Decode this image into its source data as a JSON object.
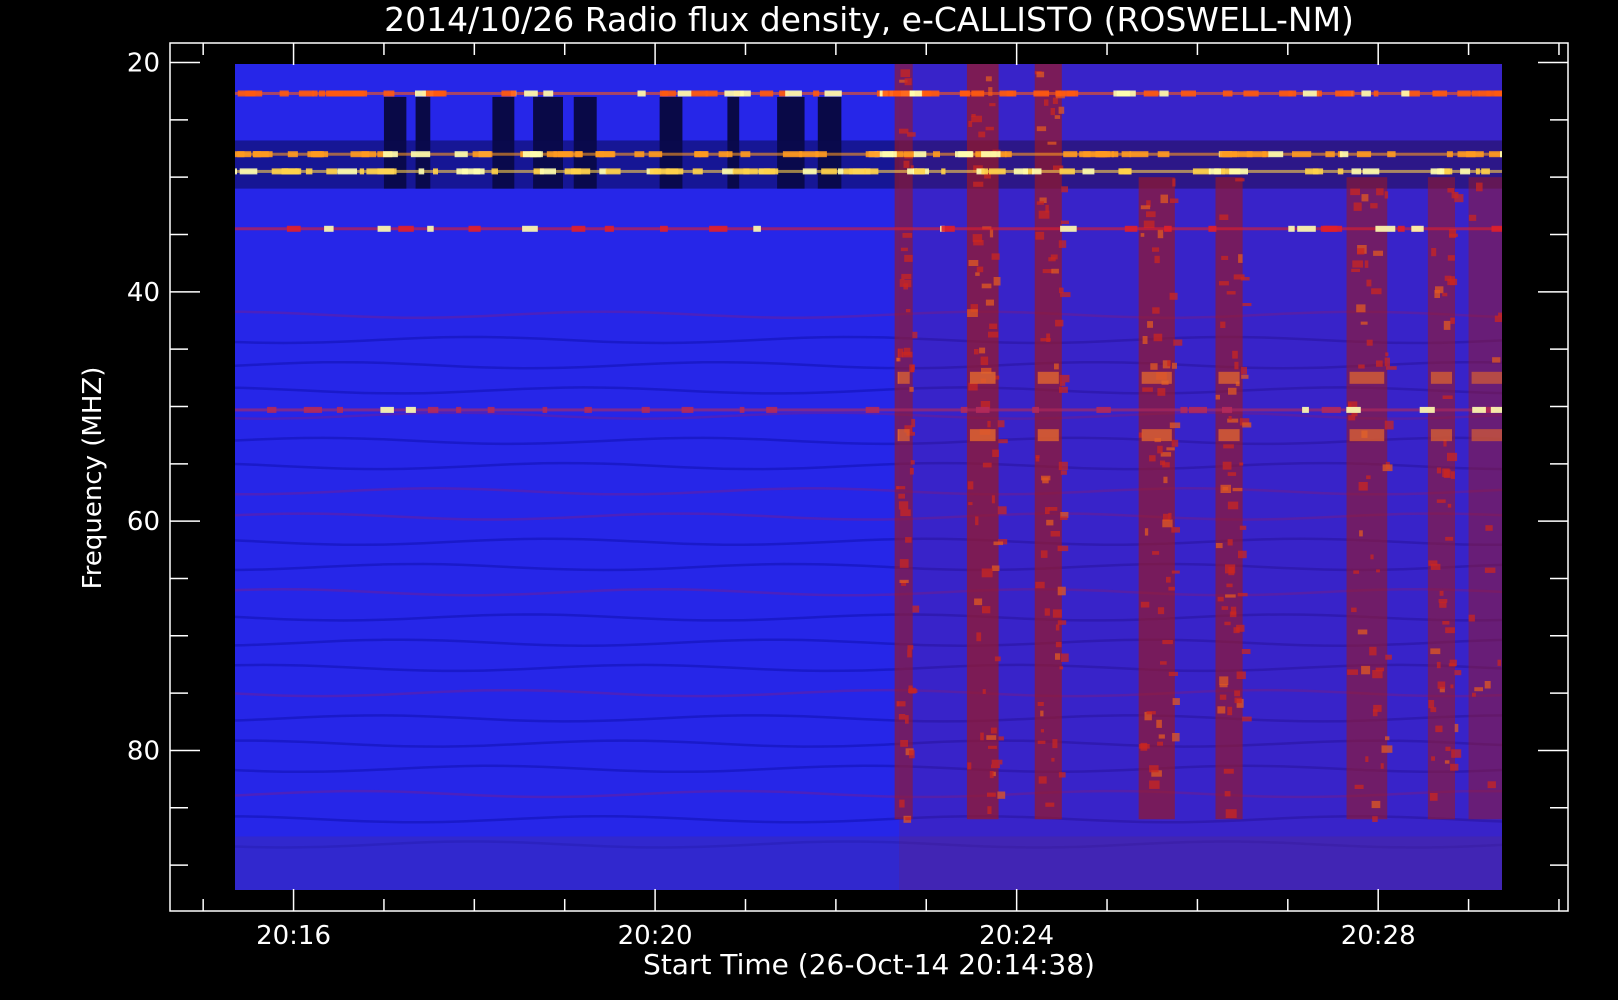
{
  "chart_data": {
    "type": "heatmap",
    "title": "2014/10/26  Radio flux density, e-CALLISTO (ROSWELL-NM)",
    "xlabel": "Start Time (26-Oct-14 20:14:38)",
    "ylabel": "Frequency (MHZ)",
    "x_ticks": [
      "20:16",
      "20:20",
      "20:24",
      "20:28"
    ],
    "x_tick_minutes": [
      16,
      20,
      24,
      28
    ],
    "x_range_minutes": [
      14.633,
      30.1
    ],
    "data_range_minutes": [
      15.0,
      30.0
    ],
    "y_ticks": [
      20,
      40,
      60,
      80
    ],
    "ylim": [
      18.3,
      94.0
    ],
    "data_freq_range_mhz": [
      20.0,
      92.3
    ],
    "y_axis_inverted": true,
    "colormap": [
      "#000000",
      "#1e1eff",
      "#b41414",
      "#ff4a00",
      "#ffd24a",
      "#ffffb0"
    ],
    "background_color": "#2626e8",
    "burst_onset_minute": 22.7,
    "bursts": [
      {
        "start_min": 22.65,
        "end_min": 22.85,
        "f_top_mhz": 20.0,
        "f_bottom_mhz": 86.0,
        "intensity": 0.55
      },
      {
        "start_min": 23.45,
        "end_min": 23.8,
        "f_top_mhz": 20.0,
        "f_bottom_mhz": 86.0,
        "intensity": 0.8
      },
      {
        "start_min": 24.2,
        "end_min": 24.5,
        "f_top_mhz": 20.0,
        "f_bottom_mhz": 86.0,
        "intensity": 0.75
      },
      {
        "start_min": 25.35,
        "end_min": 25.75,
        "f_top_mhz": 30.0,
        "f_bottom_mhz": 86.0,
        "intensity": 0.7
      },
      {
        "start_min": 26.2,
        "end_min": 26.5,
        "f_top_mhz": 30.0,
        "f_bottom_mhz": 86.0,
        "intensity": 0.65
      },
      {
        "start_min": 27.65,
        "end_min": 28.1,
        "f_top_mhz": 30.0,
        "f_bottom_mhz": 86.0,
        "intensity": 0.55
      },
      {
        "start_min": 28.55,
        "end_min": 28.85,
        "f_top_mhz": 30.0,
        "f_bottom_mhz": 86.0,
        "intensity": 0.5
      },
      {
        "start_min": 29.0,
        "end_min": 30.0,
        "f_top_mhz": 30.0,
        "f_bottom_mhz": 86.0,
        "intensity": 0.35
      }
    ],
    "interference_bands_mhz": [
      22.7,
      28.0,
      29.5,
      34.5,
      50.3
    ],
    "grid": false,
    "legend": "none"
  }
}
